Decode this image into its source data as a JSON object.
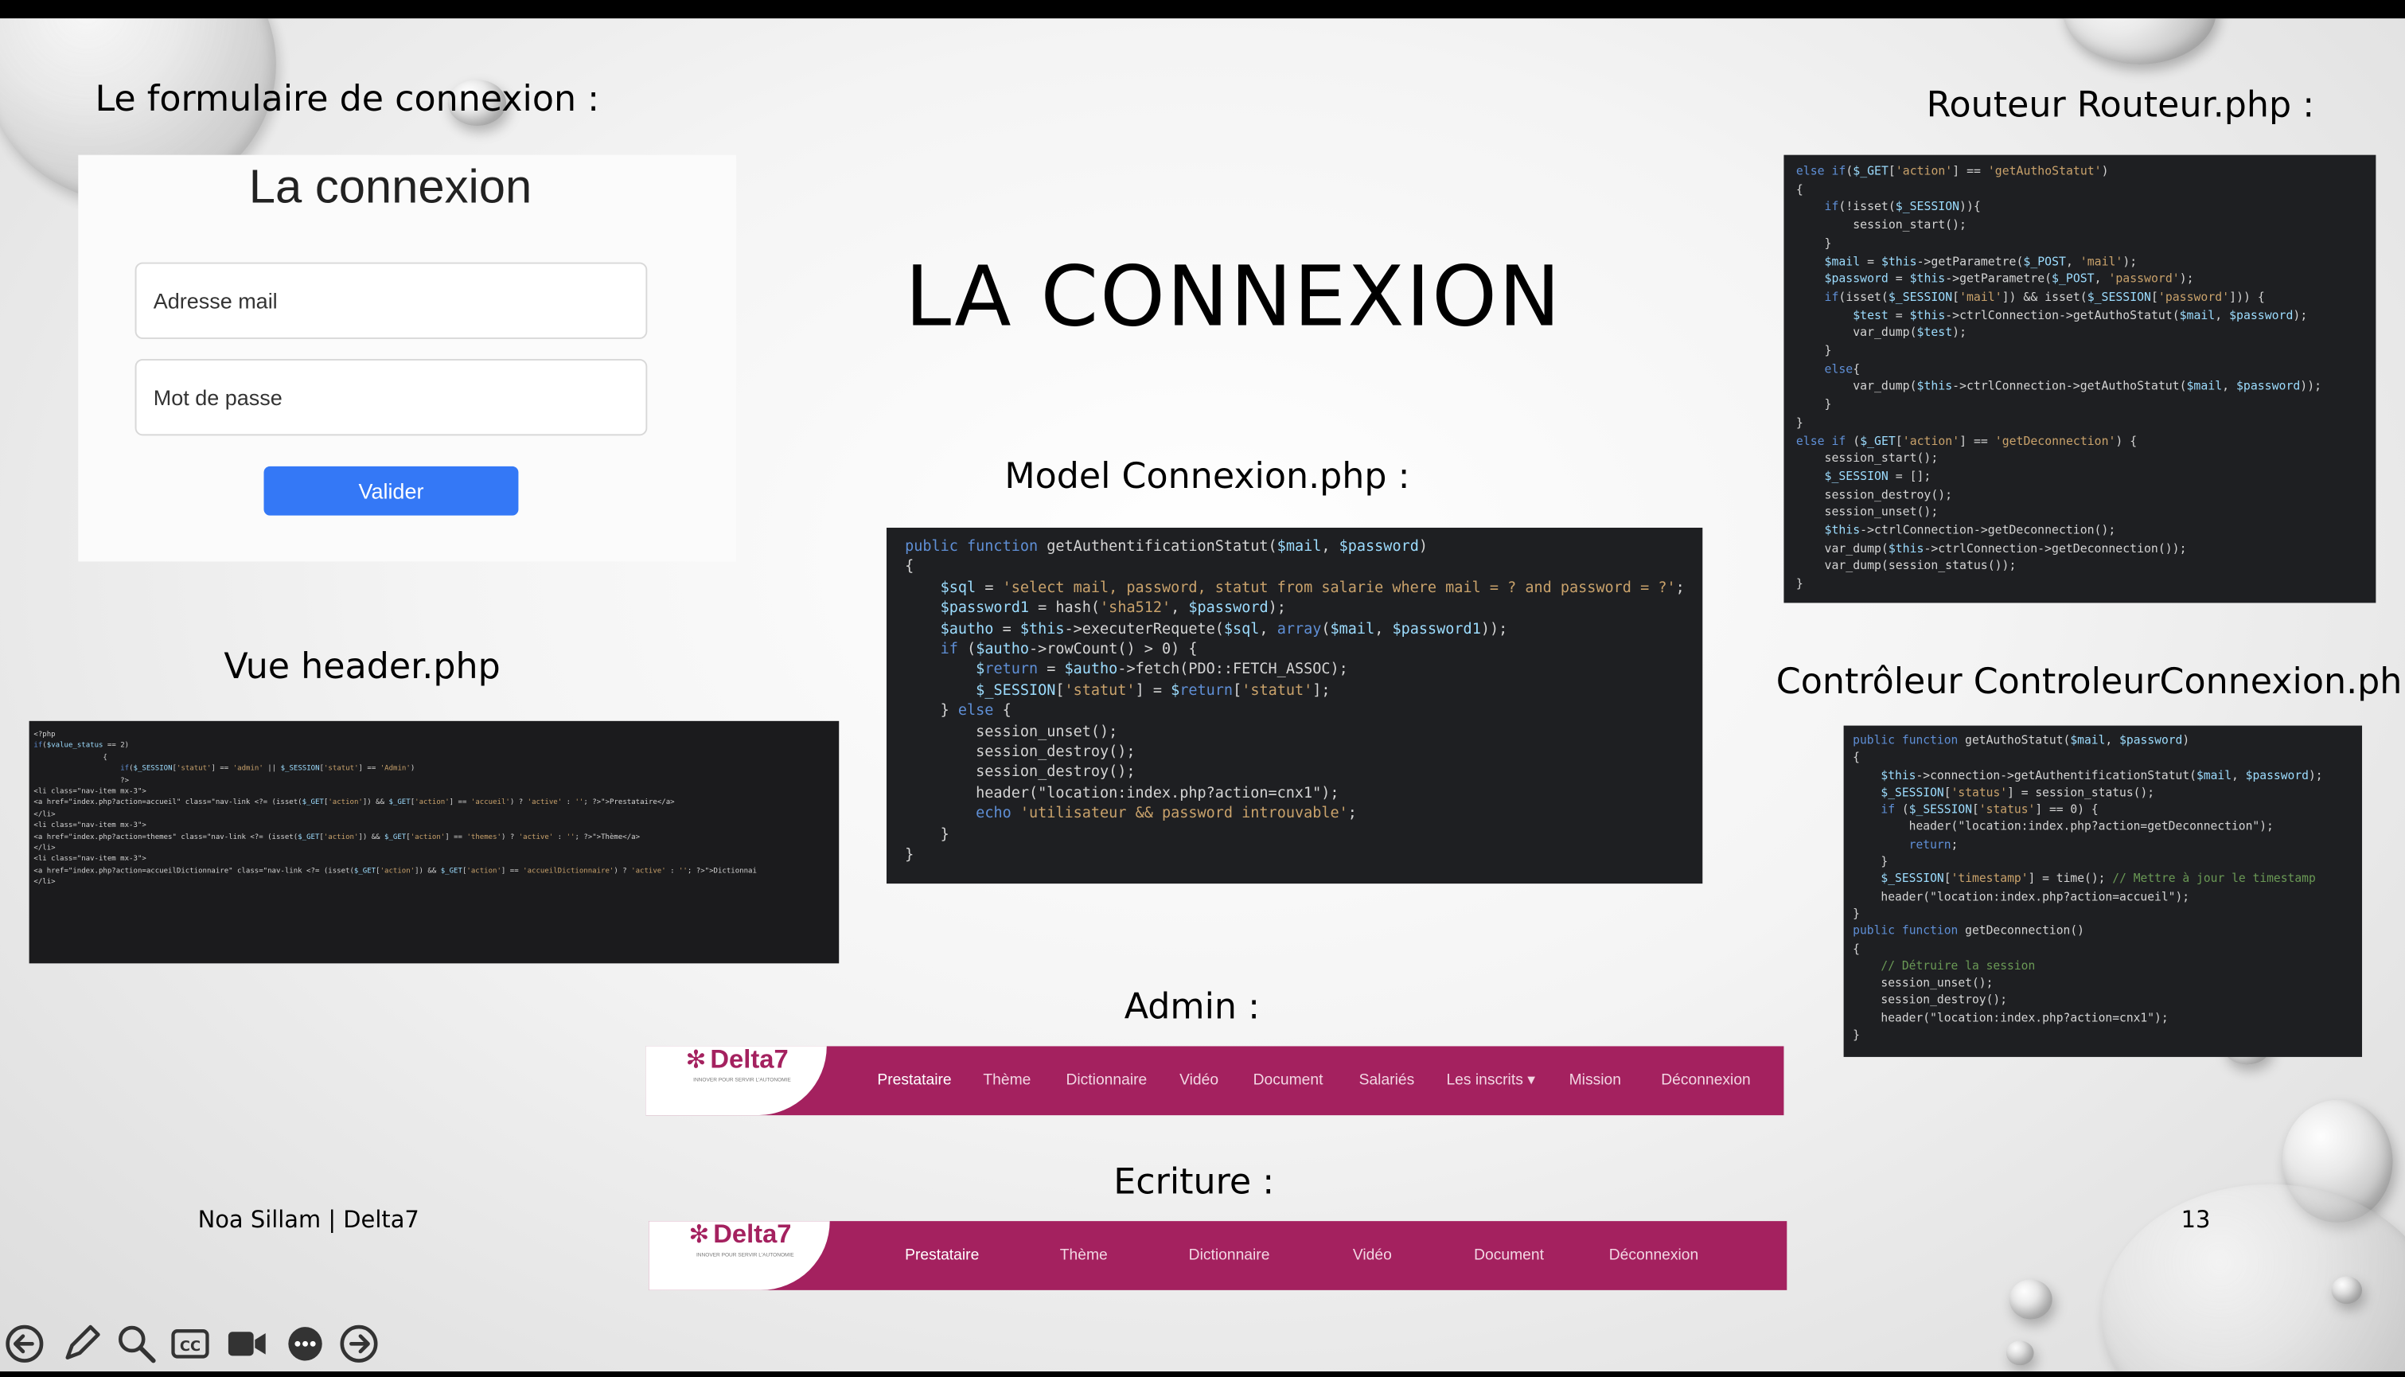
{
  "slide": {
    "title": "LA CONNEXION",
    "footer_left": "Noa Sillam | Delta7",
    "page_number": "13"
  },
  "captions": {
    "login_form": "Le formulaire de connexion :",
    "router": "Routeur Routeur.php :",
    "model": "Model Connexion.php :",
    "view": "Vue header.php",
    "controller": "Contrôleur ControleurConnexion.php :",
    "admin": "Admin :",
    "writer": "Ecriture :"
  },
  "login_form": {
    "heading": "La connexion",
    "email_placeholder": "Adresse mail",
    "password_placeholder": "Mot de passe",
    "submit_label": "Valider",
    "submit_color": "#3478f6"
  },
  "router_code": [
    "else if($_GET['action'] == 'getAuthoStatut')",
    "{",
    "    if(!isset($_SESSION)){",
    "        session_start();",
    "    }",
    "    $mail = $this->getParametre($_POST, 'mail');",
    "    $password = $this->getParametre($_POST, 'password');",
    "    if(isset($_SESSION['mail']) && isset($_SESSION['password'])) {",
    "        $test = $this->ctrlConnection->getAuthoStatut($mail, $password);",
    "        var_dump($test);",
    "    }",
    "    else{",
    "        var_dump($this->ctrlConnection->getAuthoStatut($mail, $password));",
    "    }",
    "}",
    "else if ($_GET['action'] == 'getDeconnection') {",
    "    session_start();",
    "    $_SESSION = [];",
    "    session_destroy();",
    "    session_unset();",
    "    $this->ctrlConnection->getDeconnection();",
    "    var_dump($this->ctrlConnection->getDeconnection());",
    "    var_dump(session_status());",
    "}"
  ],
  "model_code": [
    "public function getAuthentificationStatut($mail, $password)",
    "{",
    "    $sql = 'select mail, password, statut from salarie where mail = ? and password = ?';",
    "    $password1 = hash('sha512', $password);",
    "    $autho = $this->executerRequete($sql, array($mail, $password1));",
    "    if ($autho->rowCount() > 0) {",
    "        $return = $autho->fetch(PDO::FETCH_ASSOC);",
    "        $_SESSION['statut'] = $return['statut'];",
    "    } else {",
    "        session_unset();",
    "        session_destroy();",
    "        session_destroy();",
    "        header(\"location:index.php?action=cnx1\");",
    "        echo 'utilisateur && password introuvable';",
    "    }",
    "}"
  ],
  "controller_code": [
    "public function getAuthoStatut($mail, $password)",
    "{",
    "    $this->connection->getAuthentificationStatut($mail, $password);",
    "    $_SESSION['status'] = session_status();",
    "    if ($_SESSION['status'] == 0) {",
    "        header(\"location:index.php?action=getDeconnection\");",
    "        return;",
    "    }",
    "    $_SESSION['timestamp'] = time(); // Mettre à jour le timestamp",
    "    header(\"location:index.php?action=accueil\");",
    "}",
    "public function getDeconnection()",
    "{",
    "    // Détruire la session",
    "    session_unset();",
    "    session_destroy();",
    "    header(\"location:index.php?action=cnx1\");",
    "}"
  ],
  "view_code": [
    "<?php",
    "",
    "if($value_status == 2)",
    "                {",
    "",
    "",
    "",
    "                    if($_SESSION['statut'] == 'admin' || $_SESSION['statut'] == 'Admin')",
    "                    ?>",
    "<li class=\"nav-item mx-3\">",
    "<a href=\"index.php?action=accueil\" class=\"nav-link <?= (isset($_GET['action']) && $_GET['action'] == 'accueil') ? 'active' : ''; ?>\">Prestataire</a>",
    "",
    "</li>",
    "<li class=\"nav-item mx-3\">",
    "<a href=\"index.php?action=themes\" class=\"nav-link <?= (isset($_GET['action']) && $_GET['action'] == 'themes') ? 'active' : ''; ?>\">Thème</a>",
    "",
    "</li>",
    "<li class=\"nav-item mx-3\">",
    "<a href=\"index.php?action=accueilDictionnaire\" class=\"nav-link <?= (isset($_GET['action']) && $_GET['action'] == 'accueilDictionnaire') ? 'active' : ''; ?>\">Dictionnai",
    "</li>"
  ],
  "brand": {
    "logo_text": "Delta7",
    "tagline": "INNOVER POUR SERVIR L'AUTONOMIE",
    "color": "#a4215f"
  },
  "admin_nav": [
    "Prestataire",
    "Thème",
    "Dictionnaire",
    "Vidéo",
    "Document",
    "Salariés",
    "Les inscrits ▾",
    "Mission",
    "Déconnexion"
  ],
  "writer_nav": [
    "Prestataire",
    "Thème",
    "Dictionnaire",
    "Vidéo",
    "Document",
    "Déconnexion"
  ],
  "toolbar": [
    "back-icon",
    "pen-icon",
    "zoom-icon",
    "captions-icon",
    "video-icon",
    "more-icon",
    "forward-icon"
  ]
}
